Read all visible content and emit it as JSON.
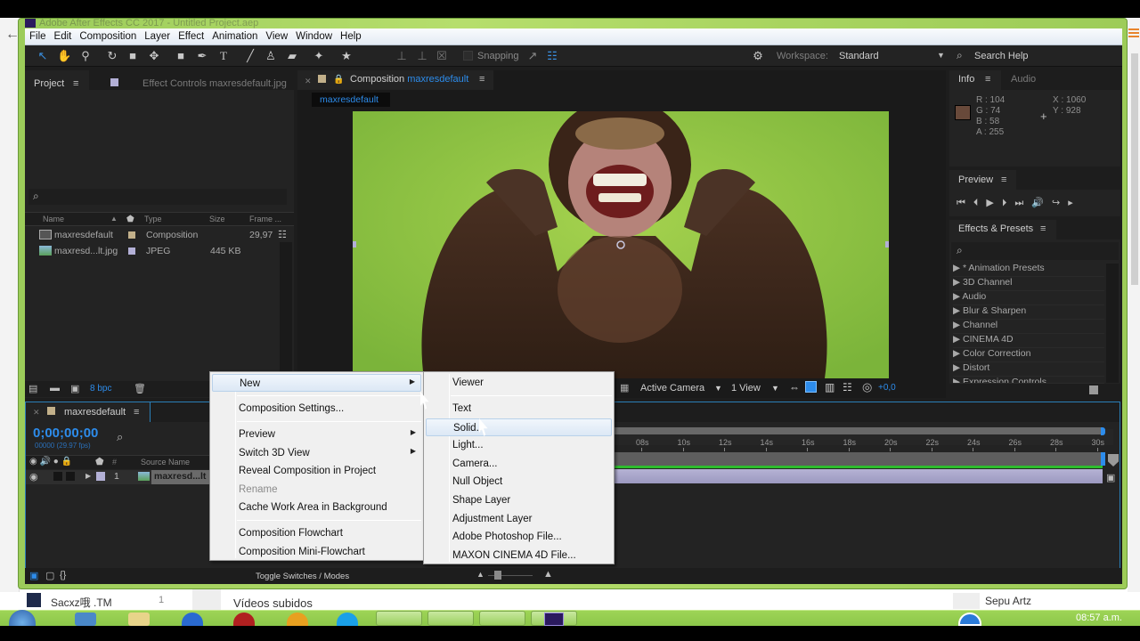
{
  "window": {
    "title": "Adobe After Effects CC 2017 - Untitled Project.aep"
  },
  "menubar": [
    "File",
    "Edit",
    "Composition",
    "Layer",
    "Effect",
    "Animation",
    "View",
    "Window",
    "Help"
  ],
  "toolbar": {
    "tools": [
      "selection-tool",
      "hand-tool",
      "zoom-tool",
      "rotation-tool",
      "camera-tool",
      "pan-behind-tool",
      "rectangle-tool",
      "pen-tool",
      "type-tool",
      "brush-tool",
      "clone-stamp-tool",
      "eraser-tool",
      "roto-brush-tool",
      "puppet-pin-tool"
    ],
    "snapping_label": "Snapping",
    "workspace_label": "Workspace:",
    "workspace_value": "Standard",
    "search_help": "Search Help"
  },
  "project_panel": {
    "tab": "Project",
    "effect_controls_tab": "Effect Controls  maxresdefault.jpg",
    "columns": [
      "Name",
      "Type",
      "Size",
      "Frame ..."
    ],
    "items": [
      {
        "name": "maxresdefault",
        "type": "Composition",
        "size": "",
        "frame_rate": "29,97",
        "label_color": "#c2b08a"
      },
      {
        "name": "maxresd...lt.jpg",
        "type": "JPEG",
        "size": "445 KB",
        "frame_rate": "",
        "label_color": "#b3b0d6"
      }
    ],
    "bpc": "8 bpc"
  },
  "composition_panel": {
    "tab_prefix": "Composition",
    "tab_name": "maxresdefault",
    "subtab": "maxresdefault",
    "camera": "Active Camera",
    "views": "1 View",
    "exposure": "+0,0"
  },
  "info_panel": {
    "tab": "Info",
    "audio_tab": "Audio",
    "r": "R : 104",
    "g": "G : 74",
    "b": "B : 58",
    "a": "A : 255",
    "x": "X : 1060",
    "y": "Y : 928",
    "swatch_color": "#68493a"
  },
  "preview_panel": {
    "tab": "Preview"
  },
  "effects_panel": {
    "tab": "Effects & Presets",
    "items": [
      "* Animation Presets",
      "3D Channel",
      "Audio",
      "Blur & Sharpen",
      "Channel",
      "CINEMA 4D",
      "Color Correction",
      "Distort",
      "Expression Controls"
    ]
  },
  "timeline": {
    "tab": "maxresdefault",
    "timecode": "0;00;00;00",
    "fps_info": "00000 (29.97 fps)",
    "col_source_name": "Source Name",
    "layer_index": "1",
    "layer_name": "maxresd...lt",
    "ticks": [
      "08s",
      "10s",
      "12s",
      "14s",
      "16s",
      "18s",
      "20s",
      "22s",
      "24s",
      "26s",
      "28s",
      "30s"
    ],
    "toggle_label": "Toggle Switches / Modes"
  },
  "context_menu": {
    "items": [
      {
        "label": "New",
        "submenu": true,
        "highlighted": true
      },
      {
        "sep": true
      },
      {
        "label": "Composition Settings..."
      },
      {
        "sep": true
      },
      {
        "label": "Preview",
        "submenu": true
      },
      {
        "label": "Switch 3D View",
        "submenu": true
      },
      {
        "label": "Reveal Composition in Project"
      },
      {
        "label": "Rename",
        "disabled": true
      },
      {
        "label": "Cache Work Area in Background"
      },
      {
        "sep": true
      },
      {
        "label": "Composition Flowchart"
      },
      {
        "label": "Composition Mini-Flowchart"
      }
    ]
  },
  "submenu_new": {
    "items": [
      {
        "label": "Viewer"
      },
      {
        "sep": true
      },
      {
        "label": "Text"
      },
      {
        "label": "Solid...",
        "highlighted": true
      },
      {
        "label": "Light..."
      },
      {
        "label": "Camera..."
      },
      {
        "label": "Null Object"
      },
      {
        "label": "Shape Layer"
      },
      {
        "label": "Adjustment Layer"
      },
      {
        "label": "Adobe Photoshop File..."
      },
      {
        "label": "MAXON CINEMA 4D File..."
      }
    ]
  },
  "background_page": {
    "channel_name": "Sacxz哦 .TM",
    "channel_count": "1",
    "section_title": "Vídeos subidos",
    "right_user": "Sepu Artz"
  },
  "taskbar": {
    "clock": "08:57 a.m."
  }
}
